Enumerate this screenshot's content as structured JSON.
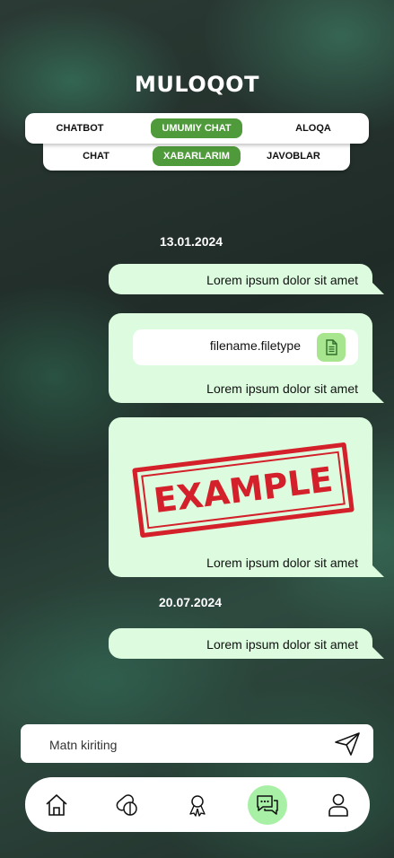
{
  "header": {
    "title": "MULOQOT"
  },
  "tabs_row1": [
    {
      "label": "CHATBOT",
      "active": false
    },
    {
      "label": "UMUMIY CHAT",
      "active": true
    },
    {
      "label": "ALOQA",
      "active": false
    }
  ],
  "tabs_row2": [
    {
      "label": "CHAT",
      "active": false
    },
    {
      "label": "XABARLARIM",
      "active": true
    },
    {
      "label": "JAVOBLAR",
      "active": false
    }
  ],
  "messages": {
    "date1": "13.01.2024",
    "msg1": "Lorem ipsum dolor sit amet",
    "msg2_file": "filename.filetype",
    "msg2": "Lorem ipsum dolor sit amet",
    "msg3_image": "EXAMPLE",
    "msg3": "Lorem ipsum dolor sit amet",
    "date2": "20.07.2024",
    "msg4": "Lorem ipsum dolor sit amet"
  },
  "composer": {
    "placeholder": "Matn kiriting",
    "send_icon": "send-icon"
  },
  "bottom_nav": [
    {
      "icon": "home-icon",
      "active": false
    },
    {
      "icon": "pills-icon",
      "active": false
    },
    {
      "icon": "award-icon",
      "active": false
    },
    {
      "icon": "chat-icon",
      "active": true
    },
    {
      "icon": "user-icon",
      "active": false
    }
  ],
  "colors": {
    "accent": "#4f9a3a",
    "bubble": "#ddfcdf",
    "nav_active": "#a8f0a6",
    "stamp": "#d4202a"
  }
}
